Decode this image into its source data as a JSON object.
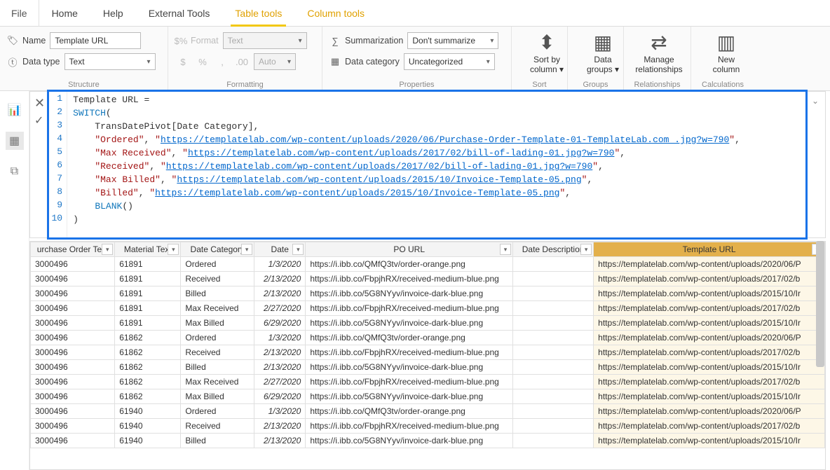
{
  "tabs": {
    "file": "File",
    "home": "Home",
    "help": "Help",
    "external": "External Tools",
    "table_tools": "Table tools",
    "column_tools": "Column tools"
  },
  "structure": {
    "name_label": "Name",
    "name_value": "Template URL",
    "datatype_label": "Data type",
    "datatype_value": "Text",
    "group": "Structure"
  },
  "formatting": {
    "format_label": "Format",
    "format_value": "Text",
    "auto": "Auto",
    "dollar": "$",
    "percent": "%",
    "comma": ",",
    "dec": ".00",
    "group": "Formatting"
  },
  "properties": {
    "sum_label": "Summarization",
    "sum_value": "Don't summarize",
    "cat_label": "Data category",
    "cat_value": "Uncategorized",
    "group": "Properties"
  },
  "sort_group": {
    "label1": "Sort by",
    "label2": "column",
    "group": "Sort"
  },
  "groups_group": {
    "label1": "Data",
    "label2": "groups",
    "group": "Groups"
  },
  "rel_group": {
    "label1": "Manage",
    "label2": "relationships",
    "group": "Relationships"
  },
  "calc_group": {
    "label1": "New",
    "label2": "column",
    "group": "Calculations"
  },
  "formula": {
    "lines": [
      "Template URL =",
      "SWITCH(",
      "    TransDatePivot[Date Category],",
      "    \"Ordered\", \"https://templatelab.com/wp-content/uploads/2020/06/Purchase-Order-Template-01-TemplateLab.com_.jpg?w=790\",",
      "    \"Max Received\", \"https://templatelab.com/wp-content/uploads/2017/02/bill-of-lading-01.jpg?w=790\",",
      "    \"Received\", \"https://templatelab.com/wp-content/uploads/2017/02/bill-of-lading-01.jpg?w=790\",",
      "    \"Max Billed\", \"https://templatelab.com/wp-content/uploads/2015/10/Invoice-Template-05.png\",",
      "    \"Billed\", \"https://templatelab.com/wp-content/uploads/2015/10/Invoice-Template-05.png\",",
      "    BLANK()",
      ")"
    ]
  },
  "columns": [
    "urchase Order Text",
    "Material Text",
    "Date Category",
    "Date",
    "PO URL",
    "Date Description",
    "Template URL"
  ],
  "rows": [
    {
      "po": "3000496",
      "mat": "61891",
      "dc": "Ordered",
      "date": "1/3/2020",
      "url": "https://i.ibb.co/QMfQ3tv/order-orange.png",
      "dd": "",
      "tu": "https://templatelab.com/wp-content/uploads/2020/06/P"
    },
    {
      "po": "3000496",
      "mat": "61891",
      "dc": "Received",
      "date": "2/13/2020",
      "url": "https://i.ibb.co/FbpjhRX/received-medium-blue.png",
      "dd": "",
      "tu": "https://templatelab.com/wp-content/uploads/2017/02/b"
    },
    {
      "po": "3000496",
      "mat": "61891",
      "dc": "Billed",
      "date": "2/13/2020",
      "url": "https://i.ibb.co/5G8NYyv/invoice-dark-blue.png",
      "dd": "",
      "tu": "https://templatelab.com/wp-content/uploads/2015/10/Ir"
    },
    {
      "po": "3000496",
      "mat": "61891",
      "dc": "Max Received",
      "date": "2/27/2020",
      "url": "https://i.ibb.co/FbpjhRX/received-medium-blue.png",
      "dd": "",
      "tu": "https://templatelab.com/wp-content/uploads/2017/02/b"
    },
    {
      "po": "3000496",
      "mat": "61891",
      "dc": "Max Billed",
      "date": "6/29/2020",
      "url": "https://i.ibb.co/5G8NYyv/invoice-dark-blue.png",
      "dd": "",
      "tu": "https://templatelab.com/wp-content/uploads/2015/10/Ir"
    },
    {
      "po": "3000496",
      "mat": "61862",
      "dc": "Ordered",
      "date": "1/3/2020",
      "url": "https://i.ibb.co/QMfQ3tv/order-orange.png",
      "dd": "",
      "tu": "https://templatelab.com/wp-content/uploads/2020/06/P"
    },
    {
      "po": "3000496",
      "mat": "61862",
      "dc": "Received",
      "date": "2/13/2020",
      "url": "https://i.ibb.co/FbpjhRX/received-medium-blue.png",
      "dd": "",
      "tu": "https://templatelab.com/wp-content/uploads/2017/02/b"
    },
    {
      "po": "3000496",
      "mat": "61862",
      "dc": "Billed",
      "date": "2/13/2020",
      "url": "https://i.ibb.co/5G8NYyv/invoice-dark-blue.png",
      "dd": "",
      "tu": "https://templatelab.com/wp-content/uploads/2015/10/Ir"
    },
    {
      "po": "3000496",
      "mat": "61862",
      "dc": "Max Received",
      "date": "2/27/2020",
      "url": "https://i.ibb.co/FbpjhRX/received-medium-blue.png",
      "dd": "",
      "tu": "https://templatelab.com/wp-content/uploads/2017/02/b"
    },
    {
      "po": "3000496",
      "mat": "61862",
      "dc": "Max Billed",
      "date": "6/29/2020",
      "url": "https://i.ibb.co/5G8NYyv/invoice-dark-blue.png",
      "dd": "",
      "tu": "https://templatelab.com/wp-content/uploads/2015/10/Ir"
    },
    {
      "po": "3000496",
      "mat": "61940",
      "dc": "Ordered",
      "date": "1/3/2020",
      "url": "https://i.ibb.co/QMfQ3tv/order-orange.png",
      "dd": "",
      "tu": "https://templatelab.com/wp-content/uploads/2020/06/P"
    },
    {
      "po": "3000496",
      "mat": "61940",
      "dc": "Received",
      "date": "2/13/2020",
      "url": "https://i.ibb.co/FbpjhRX/received-medium-blue.png",
      "dd": "",
      "tu": "https://templatelab.com/wp-content/uploads/2017/02/b"
    },
    {
      "po": "3000496",
      "mat": "61940",
      "dc": "Billed",
      "date": "2/13/2020",
      "url": "https://i.ibb.co/5G8NYyv/invoice-dark-blue.png",
      "dd": "",
      "tu": "https://templatelab.com/wp-content/uploads/2015/10/Ir"
    }
  ]
}
